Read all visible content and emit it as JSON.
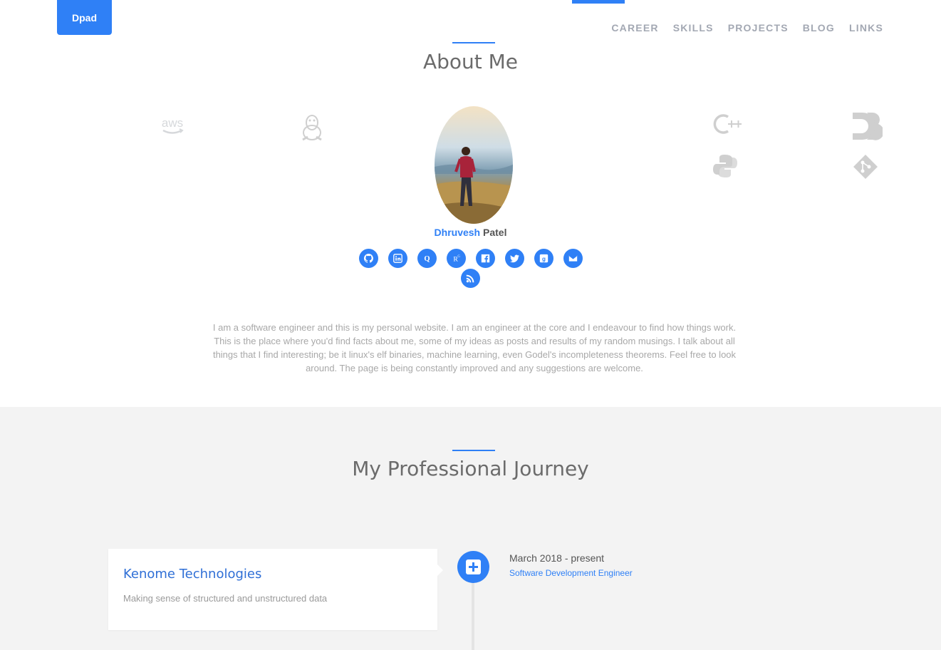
{
  "header": {
    "brand": "Dpad",
    "nav": [
      "CAREER",
      "SKILLS",
      "PROJECTS",
      "BLOG",
      "LINKS"
    ]
  },
  "about": {
    "title": "About Me",
    "first_name": "Dhruvesh",
    "last_name": "Patel",
    "tech_icons": [
      "aws-icon",
      "linux-tux-icon",
      "cplusplus-icon",
      "python-icon",
      "d3-icon",
      "git-icon"
    ],
    "aws_text": "aws",
    "socials": [
      "github-icon",
      "linkedin-icon",
      "quora-icon",
      "researchgate-icon",
      "facebook-icon",
      "twitter-icon",
      "goodreads-icon",
      "email-icon",
      "rss-icon"
    ],
    "bio": "I am a software engineer and this is my personal website. I am an engineer at the core and I endeavour to find how things work. This is the place where you'd find facts about me, some of my ideas as posts and results of my random musings. I talk about all things that I find interesting; be it linux's elf binaries, machine learning, even Godel's incompleteness theorems. Feel free to look around. The page is being constantly improved and any suggestions are welcome."
  },
  "journey": {
    "title": "My Professional Journey",
    "entries": [
      {
        "company": "Kenome Technologies",
        "tagline": "Making sense of structured and unstructured data",
        "date": "March 2018 - present",
        "role": "Software Development Engineer"
      }
    ]
  },
  "colors": {
    "accent": "#2f80f6",
    "nav_text": "#a3a8b3",
    "journey_bg": "#f3f3f3"
  }
}
